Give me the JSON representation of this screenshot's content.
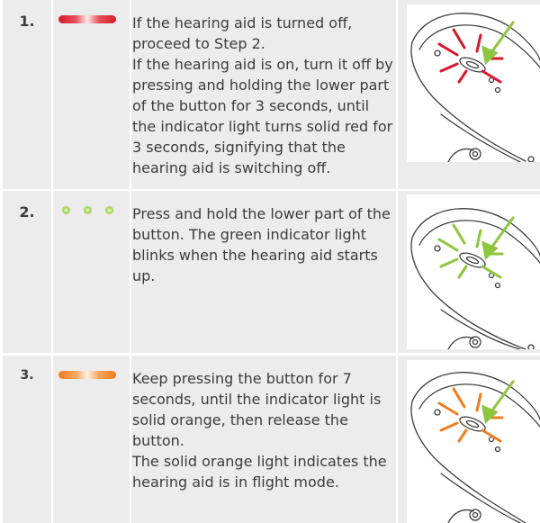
{
  "steps": [
    {
      "number": "1.",
      "indicator": "solid-red-light",
      "indicator_color": "#d7182a",
      "lines": [
        "If the hearing aid is turned off, proceed to Step 2.",
        "If the hearing aid is on, turn it off by pressing and holding the lower part of the button for 3 seconds, until the indicator light turns solid red for 3 seconds, signifying that the hearing aid is switching off."
      ],
      "illustration": "hearing-aid-red-light-illustration"
    },
    {
      "number": "2.",
      "indicator": "blinking-green-light",
      "indicator_color": "#8dc63f",
      "lines": [
        "Press and hold the lower part of the button. The green indicator light blinks when the hearing aid starts up."
      ],
      "illustration": "hearing-aid-green-light-illustration"
    },
    {
      "number": "3.",
      "indicator": "solid-orange-light",
      "indicator_color": "#ef7d1e",
      "lines": [
        "Keep pressing the button  for 7 seconds, until the indicator light is solid orange, then release the button.",
        "The solid orange light indicates the hearing aid is in flight mode."
      ],
      "illustration": "hearing-aid-orange-light-illustration"
    }
  ],
  "colors": {
    "row_background": "#ececec",
    "text": "#3c3c3c",
    "arrow": "#8dc63f",
    "red": "#d7182a",
    "green": "#8dc63f",
    "orange": "#ef7d1e"
  }
}
